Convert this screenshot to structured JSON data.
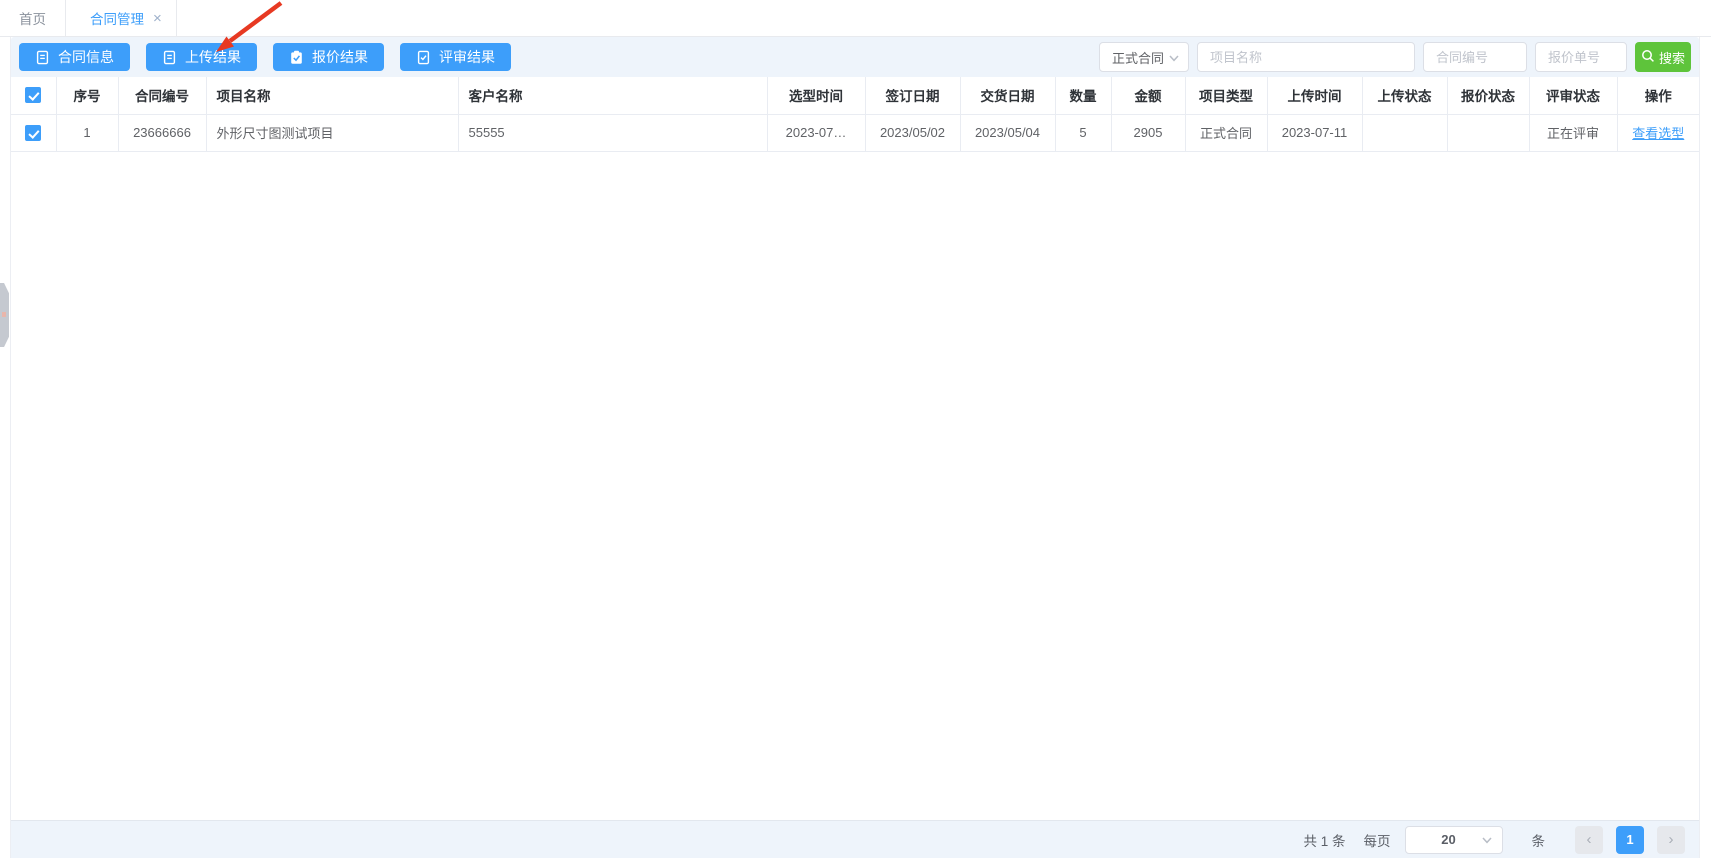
{
  "tabs": {
    "home": "首页",
    "contract_mgmt": "合同管理",
    "close_glyph": "×"
  },
  "toolbar": {
    "contract_info": "合同信息",
    "upload_result": "上传结果",
    "quote_result": "报价结果",
    "review_result": "评审结果"
  },
  "filters": {
    "contract_type_value": "正式合同",
    "project_name_placeholder": "项目名称",
    "contract_no_placeholder": "合同编号",
    "quote_no_placeholder": "报价单号",
    "search_label": "搜索"
  },
  "table": {
    "columns": [
      "序号",
      "合同编号",
      "项目名称",
      "客户名称",
      "选型时间",
      "签订日期",
      "交货日期",
      "数量",
      "金额",
      "项目类型",
      "上传时间",
      "上传状态",
      "报价状态",
      "评审状态",
      "操作"
    ],
    "select_all_checked": true,
    "row": {
      "checked": true,
      "seq": "1",
      "contract_no": "23666666",
      "project_name": "外形尺寸图测试项目",
      "customer_name": "55555",
      "selection_time": "2023-07…",
      "sign_date": "2023/05/02",
      "delivery_date": "2023/05/04",
      "quantity": "5",
      "amount": "2905",
      "project_type": "正式合同",
      "upload_time": "2023-07-11",
      "upload_status": "",
      "quote_status": "",
      "review_status": "正在评审",
      "action": "查看选型"
    }
  },
  "pagination": {
    "total_text": "共 1 条",
    "per_page_label": "每页",
    "page_size": "20",
    "unit_label": "条",
    "prev_glyph": "‹",
    "current_page": "1",
    "next_glyph": "›"
  },
  "colors": {
    "primary_blue": "#3d9efa",
    "search_green": "#5ec43b",
    "toolbar_bg": "#eef4fb",
    "annotation_red": "#e73922"
  }
}
